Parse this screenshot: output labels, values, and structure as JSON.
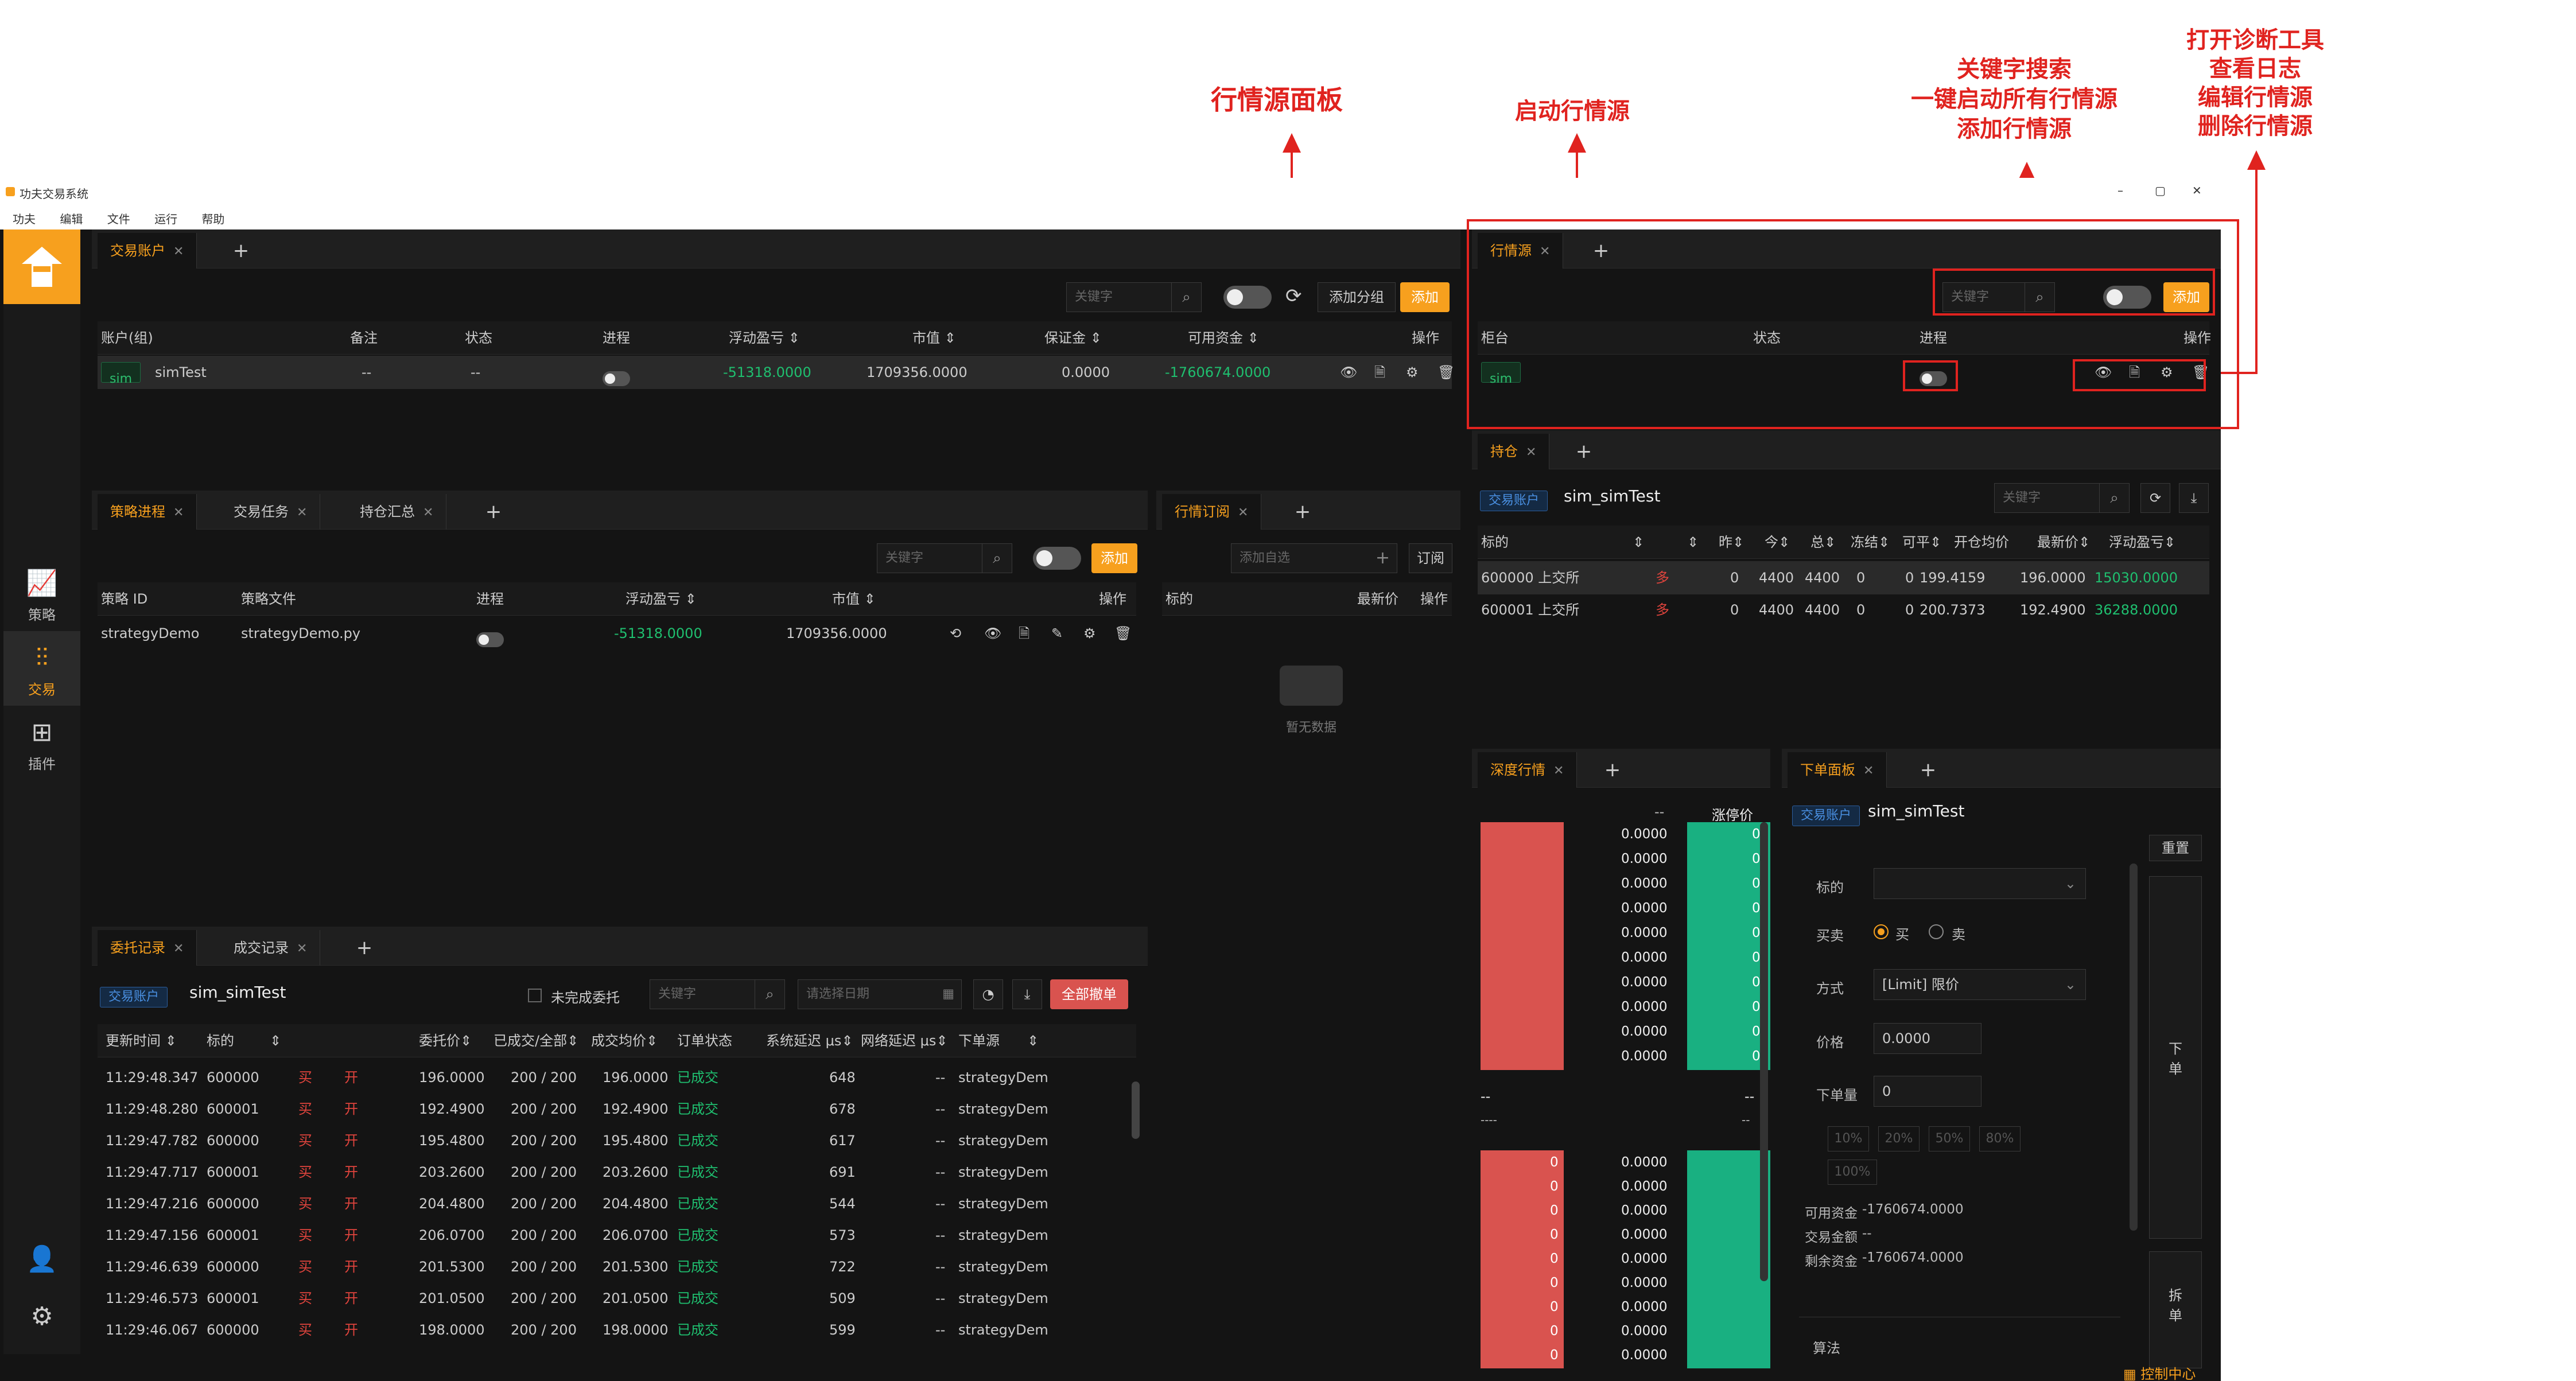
{
  "window": {
    "title": "功夫交易系统",
    "menu": [
      "功夫",
      "编辑",
      "文件",
      "运行",
      "帮助"
    ],
    "controls": [
      "–",
      "▢",
      "✕"
    ]
  },
  "sidebar": {
    "items": [
      {
        "label": "策略",
        "icon": "chart-line-icon"
      },
      {
        "label": "交易",
        "icon": "candlestick-icon"
      },
      {
        "label": "插件",
        "icon": "plugin-icon"
      }
    ]
  },
  "annotations": {
    "md_panel": "行情源面板",
    "start_md": "启动行情源",
    "search_lines": [
      "关键字搜索",
      "一键启动所有行情源",
      "添加行情源"
    ],
    "tool_lines": [
      "打开诊断工具",
      "查看日志",
      "编辑行情源",
      "删除行情源"
    ]
  },
  "accounts": {
    "tab": "交易账户",
    "search_placeholder": "关键字",
    "add_group": "添加分组",
    "add": "添加",
    "headers": [
      "账户(组)",
      "备注",
      "状态",
      "进程",
      "浮动盈亏 ⇕",
      "市值 ⇕",
      "保证金 ⇕",
      "可用资金 ⇕",
      "操作"
    ],
    "rows": [
      {
        "tag": "sim",
        "name": "simTest",
        "remark": "--",
        "status": "--",
        "pnl": "-51318.0000",
        "market": "1709356.0000",
        "margin": "0.0000",
        "avail": "-1760674.0000"
      }
    ]
  },
  "md": {
    "tab": "行情源",
    "search_placeholder": "关键字",
    "add": "添加",
    "headers": [
      "柜台",
      "状态",
      "进程",
      "操作"
    ],
    "rows": [
      {
        "tag": "sim"
      }
    ]
  },
  "strategy": {
    "tabs": [
      "策略进程",
      "交易任务",
      "持仓汇总"
    ],
    "search_placeholder": "关键字",
    "add": "添加",
    "headers": [
      "策略 ID",
      "策略文件",
      "进程",
      "浮动盈亏 ⇕",
      "市值 ⇕",
      "操作"
    ],
    "rows": [
      {
        "id": "strategyDemo",
        "file": "strategyDemo.py",
        "pnl": "-51318.0000",
        "market": "1709356.0000"
      }
    ]
  },
  "subscribe": {
    "tab": "行情订阅",
    "placeholder": "添加自选",
    "btn": "订阅",
    "headers": [
      "标的",
      "最新价",
      "操作"
    ],
    "empty": "暂无数据"
  },
  "position": {
    "tab": "持仓",
    "account_tag": "交易账户",
    "account": "sim_simTest",
    "search_placeholder": "关键字",
    "headers": [
      "标的",
      "⇕",
      "⇕",
      "昨⇕",
      "今⇕",
      "总⇕",
      "冻结⇕",
      "可平⇕",
      "开仓均价",
      "最新价⇕",
      "浮动盈亏⇕"
    ],
    "rows": [
      {
        "code": "600000 上交所",
        "dir": "多",
        "yd": "0",
        "td": "4400",
        "total": "4400",
        "frozen": "0",
        "close": "0",
        "avg": "199.4159",
        "last": "196.0000",
        "pnl": "15030.0000"
      },
      {
        "code": "600001 上交所",
        "dir": "多",
        "yd": "0",
        "td": "4400",
        "total": "4400",
        "frozen": "0",
        "close": "0",
        "avg": "200.7373",
        "last": "192.4900",
        "pnl": "36288.0000"
      }
    ]
  },
  "orders": {
    "tabs": [
      "委托记录",
      "成交记录"
    ],
    "account_tag": "交易账户",
    "account": "sim_simTest",
    "unfinished": "未完成委托",
    "search_placeholder": "关键字",
    "date_placeholder": "请选择日期",
    "cancel_all": "全部撤单",
    "headers": [
      "更新时间 ⇕",
      "标的",
      "⇕",
      "委托价⇕",
      "已成交/全部⇕",
      "成交均价⇕",
      "订单状态",
      "系统延迟 μs⇕",
      "网络延迟 μs⇕",
      "下单源",
      "⇕"
    ],
    "rows": [
      {
        "t": "11:29:48.347",
        "code": "600000",
        "side": "买",
        "off": "开",
        "price": "196.0000",
        "qty": "200 / 200",
        "avg": "196.0000",
        "st": "已成交",
        "sys": "648",
        "net": "--",
        "src": "strategyDem"
      },
      {
        "t": "11:29:48.280",
        "code": "600001",
        "side": "买",
        "off": "开",
        "price": "192.4900",
        "qty": "200 / 200",
        "avg": "192.4900",
        "st": "已成交",
        "sys": "678",
        "net": "--",
        "src": "strategyDem"
      },
      {
        "t": "11:29:47.782",
        "code": "600000",
        "side": "买",
        "off": "开",
        "price": "195.4800",
        "qty": "200 / 200",
        "avg": "195.4800",
        "st": "已成交",
        "sys": "617",
        "net": "--",
        "src": "strategyDem"
      },
      {
        "t": "11:29:47.717",
        "code": "600001",
        "side": "买",
        "off": "开",
        "price": "203.2600",
        "qty": "200 / 200",
        "avg": "203.2600",
        "st": "已成交",
        "sys": "691",
        "net": "--",
        "src": "strategyDem"
      },
      {
        "t": "11:29:47.216",
        "code": "600000",
        "side": "买",
        "off": "开",
        "price": "204.4800",
        "qty": "200 / 200",
        "avg": "204.4800",
        "st": "已成交",
        "sys": "544",
        "net": "--",
        "src": "strategyDem"
      },
      {
        "t": "11:29:47.156",
        "code": "600001",
        "side": "买",
        "off": "开",
        "price": "206.0700",
        "qty": "200 / 200",
        "avg": "206.0700",
        "st": "已成交",
        "sys": "573",
        "net": "--",
        "src": "strategyDem"
      },
      {
        "t": "11:29:46.639",
        "code": "600000",
        "side": "买",
        "off": "开",
        "price": "201.5300",
        "qty": "200 / 200",
        "avg": "201.5300",
        "st": "已成交",
        "sys": "722",
        "net": "--",
        "src": "strategyDem"
      },
      {
        "t": "11:29:46.573",
        "code": "600001",
        "side": "买",
        "off": "开",
        "price": "201.0500",
        "qty": "200 / 200",
        "avg": "201.0500",
        "st": "已成交",
        "sys": "509",
        "net": "--",
        "src": "strategyDem"
      },
      {
        "t": "11:29:46.067",
        "code": "600000",
        "side": "买",
        "off": "开",
        "price": "198.0000",
        "qty": "200 / 200",
        "avg": "198.0000",
        "st": "已成交",
        "sys": "599",
        "net": "--",
        "src": "strategyDem"
      }
    ]
  },
  "depth": {
    "tab": "深度行情",
    "limit_up": "涨停价",
    "dash": "--",
    "dash4": "----",
    "ask_price": "0.0000",
    "ask_vol": "0",
    "bid_price": "0.0000",
    "bid_vol": "0"
  },
  "order_panel": {
    "tab": "下单面板",
    "account_tag": "交易账户",
    "account": "sim_simTest",
    "reset": "重置",
    "symbol": "标的",
    "side": "买卖",
    "buy": "买",
    "sell": "卖",
    "method": "方式",
    "method_value": "[Limit] 限价",
    "price": "价格",
    "price_value": "0.0000",
    "volume": "下单量",
    "volume_value": "0",
    "pcts": [
      "10%",
      "20%",
      "50%",
      "80%",
      "100%"
    ],
    "avail": "可用资金",
    "avail_value": "-1760674.0000",
    "trade_amount": "交易金额",
    "trade_amount_value": "--",
    "remain": "剩余资金",
    "remain_value": "-1760674.0000",
    "algo": "算法",
    "place": "下单",
    "split": "拆单"
  },
  "footer": {
    "control": "控制中心"
  }
}
